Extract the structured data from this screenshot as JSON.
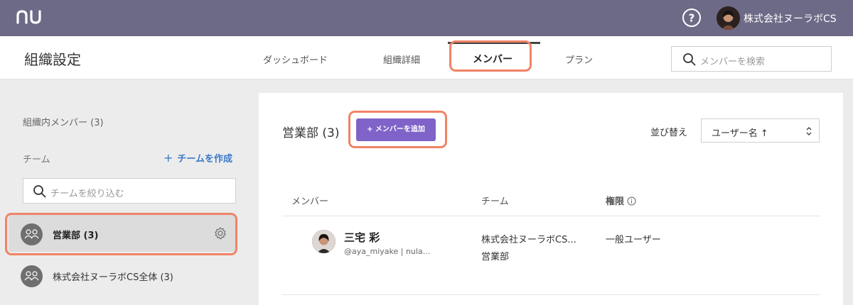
{
  "topbar": {
    "logo_text": "nu",
    "org_name": "株式会社ヌーラボCS"
  },
  "header": {
    "page_title": "組織設定",
    "tabs": [
      {
        "label": "ダッシュボード"
      },
      {
        "label": "組織詳細"
      },
      {
        "label": "メンバー"
      },
      {
        "label": "プラン"
      }
    ],
    "search_placeholder": "メンバーを検索"
  },
  "sidebar": {
    "org_members_label": "組織内メンバー (3)",
    "team_label": "チーム",
    "create_team_label": "チームを作成",
    "filter_placeholder": "チームを絞り込む",
    "teams": [
      {
        "name": "営業部 (3)"
      },
      {
        "name": "株式会社ヌーラボCS全体 (3)"
      }
    ]
  },
  "main": {
    "team_title": "営業部 (3)",
    "add_member_label": "+ メンバーを追加",
    "sort_label": "並び替え",
    "sort_value": "ユーザー名 ↑",
    "columns": {
      "member": "メンバー",
      "team": "チーム",
      "role": "権限"
    },
    "members": [
      {
        "name": "三宅 彩",
        "id": "@aya_miyake | nula...",
        "team_line1": "株式会社ヌーラボCS...",
        "team_line2": "営業部",
        "role": "一般ユーザー"
      }
    ]
  },
  "colors": {
    "topbar": "#6d6a87",
    "accent_button": "#7f63c9",
    "highlight": "#f08366",
    "link": "#3c79c7"
  }
}
